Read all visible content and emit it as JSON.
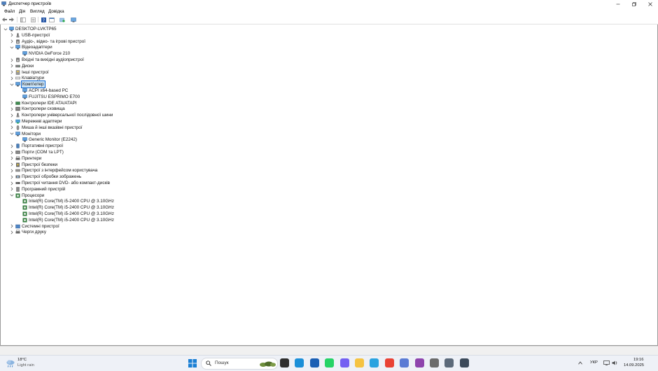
{
  "window": {
    "title": "Диспетчер пристроїв"
  },
  "menu": [
    "Файл",
    "Дія",
    "Вигляд",
    "Довідка"
  ],
  "tree": {
    "root": "DESKTOP-LVKTP65",
    "rows": [
      {
        "level": 1,
        "expanded": false,
        "icon": "usb-icon",
        "label": "USB-пристрої"
      },
      {
        "level": 1,
        "expanded": false,
        "icon": "speaker-icon",
        "label": "Аудіо-, відео- та ігрові пристрої"
      },
      {
        "level": 1,
        "expanded": true,
        "icon": "display-adapter-icon",
        "label": "Відеоадаптери"
      },
      {
        "level": 2,
        "icon": "display-adapter-icon",
        "label": "NVIDIA GeForce 210"
      },
      {
        "level": 1,
        "expanded": false,
        "icon": "speaker-icon",
        "label": "Вхідні та вихідні аудіопристрої"
      },
      {
        "level": 1,
        "expanded": false,
        "icon": "disk-icon",
        "label": "Диски"
      },
      {
        "level": 1,
        "expanded": false,
        "icon": "device-icon",
        "label": "Інші пристрої"
      },
      {
        "level": 1,
        "expanded": false,
        "icon": "keyboard-icon",
        "label": "Клавіатури"
      },
      {
        "level": 1,
        "expanded": true,
        "icon": "computer-icon",
        "label": "Комп'ютер",
        "selected": true
      },
      {
        "level": 2,
        "icon": "computer-icon",
        "label": "ACPI x64-based PC"
      },
      {
        "level": 2,
        "icon": "computer-icon",
        "label": "FUJITSU ESPRIMO E700"
      },
      {
        "level": 1,
        "expanded": false,
        "icon": "ide-icon",
        "label": "Контролери IDE ATA/ATAPI"
      },
      {
        "level": 1,
        "expanded": false,
        "icon": "storage-icon",
        "label": "Контролери сховища"
      },
      {
        "level": 1,
        "expanded": false,
        "icon": "usb-icon",
        "label": "Контролери універсальної послідовної шини"
      },
      {
        "level": 1,
        "expanded": false,
        "icon": "network-icon",
        "label": "Мережеві адаптери"
      },
      {
        "level": 1,
        "expanded": false,
        "icon": "mouse-icon",
        "label": "Миша й інші вказівні пристрої"
      },
      {
        "level": 1,
        "expanded": true,
        "icon": "monitor-icon",
        "label": "Монітори"
      },
      {
        "level": 2,
        "icon": "monitor-icon",
        "label": "Generic Monitor (E2242)"
      },
      {
        "level": 1,
        "expanded": false,
        "icon": "portable-icon",
        "label": "Портативні пристрої"
      },
      {
        "level": 1,
        "expanded": false,
        "icon": "port-icon",
        "label": "Порти (COM та LPT)"
      },
      {
        "level": 1,
        "expanded": false,
        "icon": "printer-icon",
        "label": "Принтери"
      },
      {
        "level": 1,
        "expanded": false,
        "icon": "security-icon",
        "label": "Пристрої безпеки"
      },
      {
        "level": 1,
        "expanded": false,
        "icon": "hid-icon",
        "label": "Пристрої з інтерфейсом користувача"
      },
      {
        "level": 1,
        "expanded": false,
        "icon": "camera-icon",
        "label": "Пристрої обробки зображень"
      },
      {
        "level": 1,
        "expanded": false,
        "icon": "dvd-icon",
        "label": "Пристрої читання DVD- або компакт-дисків"
      },
      {
        "level": 1,
        "expanded": false,
        "icon": "software-icon",
        "label": "Програмний пристрій"
      },
      {
        "level": 1,
        "expanded": true,
        "icon": "processor-icon",
        "label": "Процесори"
      },
      {
        "level": 2,
        "icon": "processor-icon",
        "label": "Intel(R) Core(TM) i5-2400 CPU @ 3.10GHz"
      },
      {
        "level": 2,
        "icon": "processor-icon",
        "label": "Intel(R) Core(TM) i5-2400 CPU @ 3.10GHz"
      },
      {
        "level": 2,
        "icon": "processor-icon",
        "label": "Intel(R) Core(TM) i5-2400 CPU @ 3.10GHz"
      },
      {
        "level": 2,
        "icon": "processor-icon",
        "label": "Intel(R) Core(TM) i5-2400 CPU @ 3.10GHz"
      },
      {
        "level": 1,
        "expanded": false,
        "icon": "system-icon",
        "label": "Системні пристрої"
      },
      {
        "level": 1,
        "expanded": false,
        "icon": "print-queue-icon",
        "label": "Черги друку"
      }
    ]
  },
  "taskbar": {
    "weather": {
      "temp": "18°C",
      "condition": "Light rain"
    },
    "search_placeholder": "Пошук",
    "apps": [
      {
        "name": "file-explorer-icon",
        "color": "#2f2f2f"
      },
      {
        "name": "edge-icon",
        "color": "#1b8fd8"
      },
      {
        "name": "store-icon",
        "color": "#1a5fb4"
      },
      {
        "name": "whatsapp-icon",
        "color": "#25d366"
      },
      {
        "name": "viber-icon",
        "color": "#7360f2"
      },
      {
        "name": "folder-icon",
        "color": "#f5c342"
      },
      {
        "name": "telegram-icon",
        "color": "#2aa3e0"
      },
      {
        "name": "chrome-icon",
        "color": "#e94235"
      },
      {
        "name": "chrome-profile-icon",
        "color": "#5a7bd4"
      },
      {
        "name": "chrome-dev-icon",
        "color": "#8e44ad"
      },
      {
        "name": "settings-icon",
        "color": "#6b6b6b"
      },
      {
        "name": "device-manager-icon",
        "color": "#5c6a7a"
      },
      {
        "name": "device-manager-active-icon",
        "color": "#3c4a5a"
      }
    ],
    "tray": {
      "language": "УКР",
      "time": "19:16",
      "date": "14.09.2025"
    }
  }
}
